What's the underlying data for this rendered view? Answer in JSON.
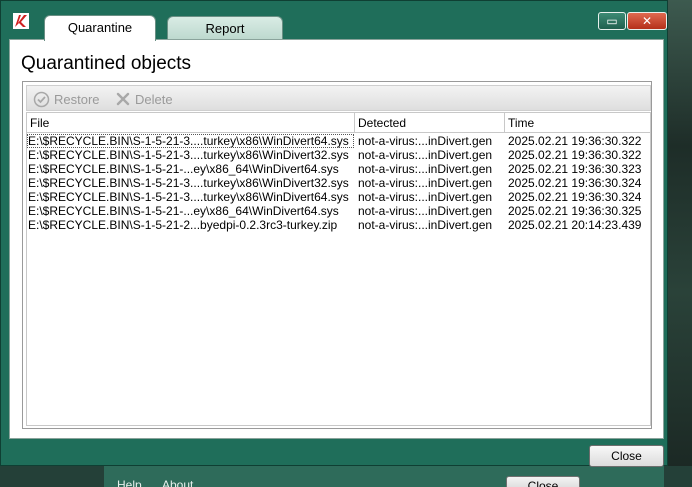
{
  "window": {
    "tabs": [
      {
        "label": "Quarantine",
        "active": true
      },
      {
        "label": "Report",
        "active": false
      }
    ],
    "minimize_glyph": "▭",
    "close_glyph": "✕"
  },
  "main": {
    "title": "Quarantined objects",
    "toolbar": {
      "restore_label": "Restore",
      "delete_label": "Delete"
    },
    "table": {
      "columns": [
        "File",
        "Detected",
        "Time"
      ],
      "rows": [
        {
          "file": "E:\\$RECYCLE.BIN\\S-1-5-21-3....turkey\\x86\\WinDivert64.sys",
          "detected": "not-a-virus:...inDivert.gen",
          "time": "2025.02.21 19:36:30.322"
        },
        {
          "file": "E:\\$RECYCLE.BIN\\S-1-5-21-3....turkey\\x86\\WinDivert32.sys",
          "detected": "not-a-virus:...inDivert.gen",
          "time": "2025.02.21 19:36:30.322"
        },
        {
          "file": "E:\\$RECYCLE.BIN\\S-1-5-21-...ey\\x86_64\\WinDivert64.sys",
          "detected": "not-a-virus:...inDivert.gen",
          "time": "2025.02.21 19:36:30.323"
        },
        {
          "file": "E:\\$RECYCLE.BIN\\S-1-5-21-3....turkey\\x86\\WinDivert32.sys",
          "detected": "not-a-virus:...inDivert.gen",
          "time": "2025.02.21 19:36:30.324"
        },
        {
          "file": "E:\\$RECYCLE.BIN\\S-1-5-21-3....turkey\\x86\\WinDivert64.sys",
          "detected": "not-a-virus:...inDivert.gen",
          "time": "2025.02.21 19:36:30.324"
        },
        {
          "file": "E:\\$RECYCLE.BIN\\S-1-5-21-...ey\\x86_64\\WinDivert64.sys",
          "detected": "not-a-virus:...inDivert.gen",
          "time": "2025.02.21 19:36:30.325"
        },
        {
          "file": "E:\\$RECYCLE.BIN\\S-1-5-21-2...byedpi-0.2.3rc3-turkey.zip",
          "detected": "not-a-virus:...inDivert.gen",
          "time": "2025.02.21 20:14:23.439"
        }
      ]
    }
  },
  "footer": {
    "close_label": "Close"
  },
  "background": {
    "help_label": "Help",
    "about_label": "About",
    "close_label": "Close"
  },
  "colors": {
    "window_frame": "#1f6e5a",
    "close_button": "#c23b22"
  },
  "icons": {
    "app": "kaspersky-k-icon",
    "restore": "check-circle-icon",
    "delete": "x-icon"
  }
}
